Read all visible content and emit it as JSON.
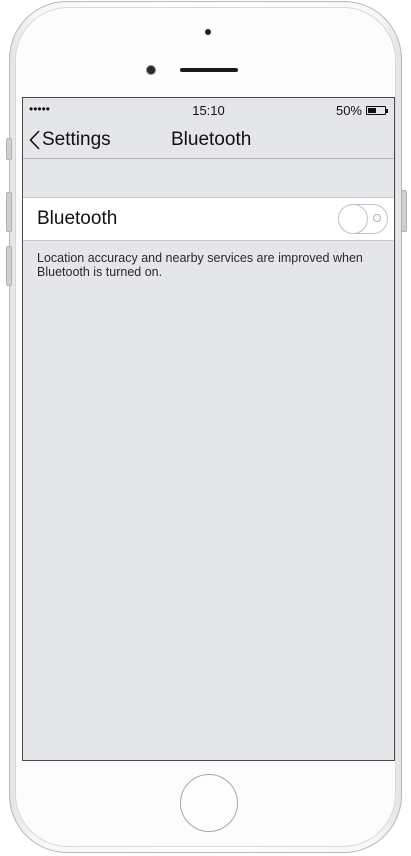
{
  "status_bar": {
    "signal": "•••••",
    "time": "15:10",
    "battery_percent": "50%",
    "battery_level": 0.5
  },
  "nav_bar": {
    "back_label": "Settings",
    "title": "Bluetooth"
  },
  "bluetooth_cell": {
    "label": "Bluetooth",
    "toggle_on": false
  },
  "footer": {
    "text": "Location accuracy and nearby services are improved when Bluetooth is turned on."
  },
  "icons": {
    "back": "chevron-left-icon",
    "battery": "battery-icon",
    "signal": "signal-dots-icon"
  },
  "colors": {
    "screen_background": "#e5e6ea",
    "cell_background": "#ffffff",
    "text": "#111111",
    "toggle_border": "#c4c4c8"
  }
}
